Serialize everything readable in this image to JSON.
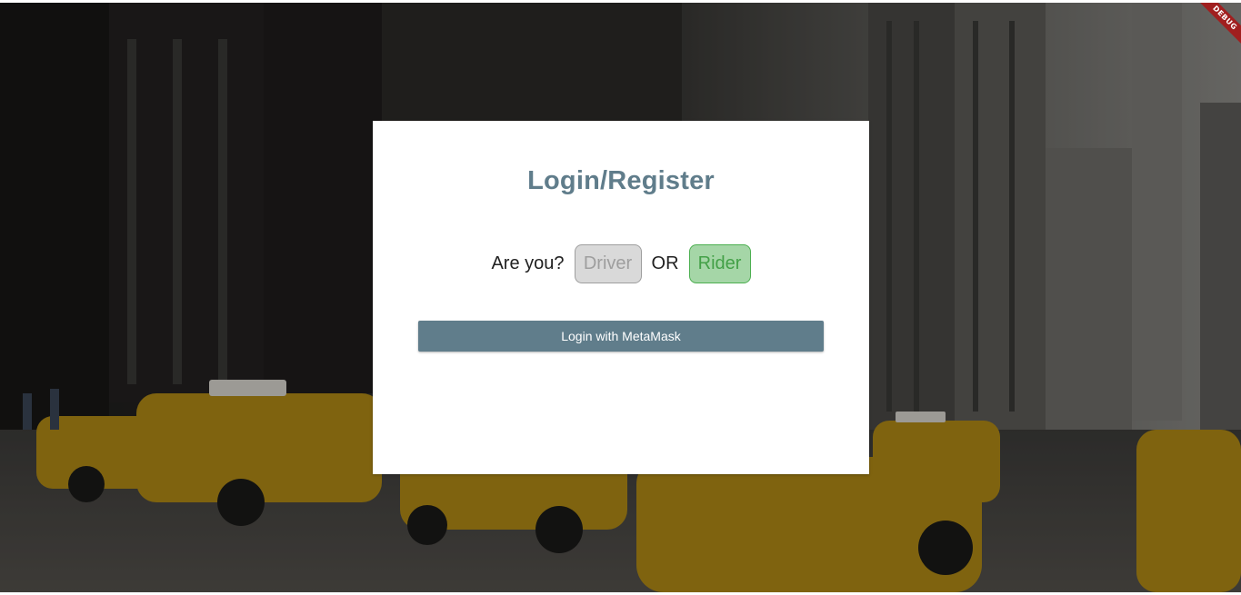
{
  "page": {
    "background_description_icon": "city-street-taxis-image",
    "debug_label": "DEBUG"
  },
  "login": {
    "title": "Login/Register",
    "prompt": "Are you?",
    "driver_label": "Driver",
    "or_label": "OR",
    "rider_label": "Rider",
    "selected_role": "Rider",
    "metamask_label": "Login with MetaMask"
  },
  "colors": {
    "title": "#607d8b",
    "primary_button": "#607d8b",
    "driver_bg": "#d9d9d9",
    "rider_bg": "#a5d6a7",
    "rider_text": "#43a047",
    "debug_ribbon": "#a01f1f"
  }
}
